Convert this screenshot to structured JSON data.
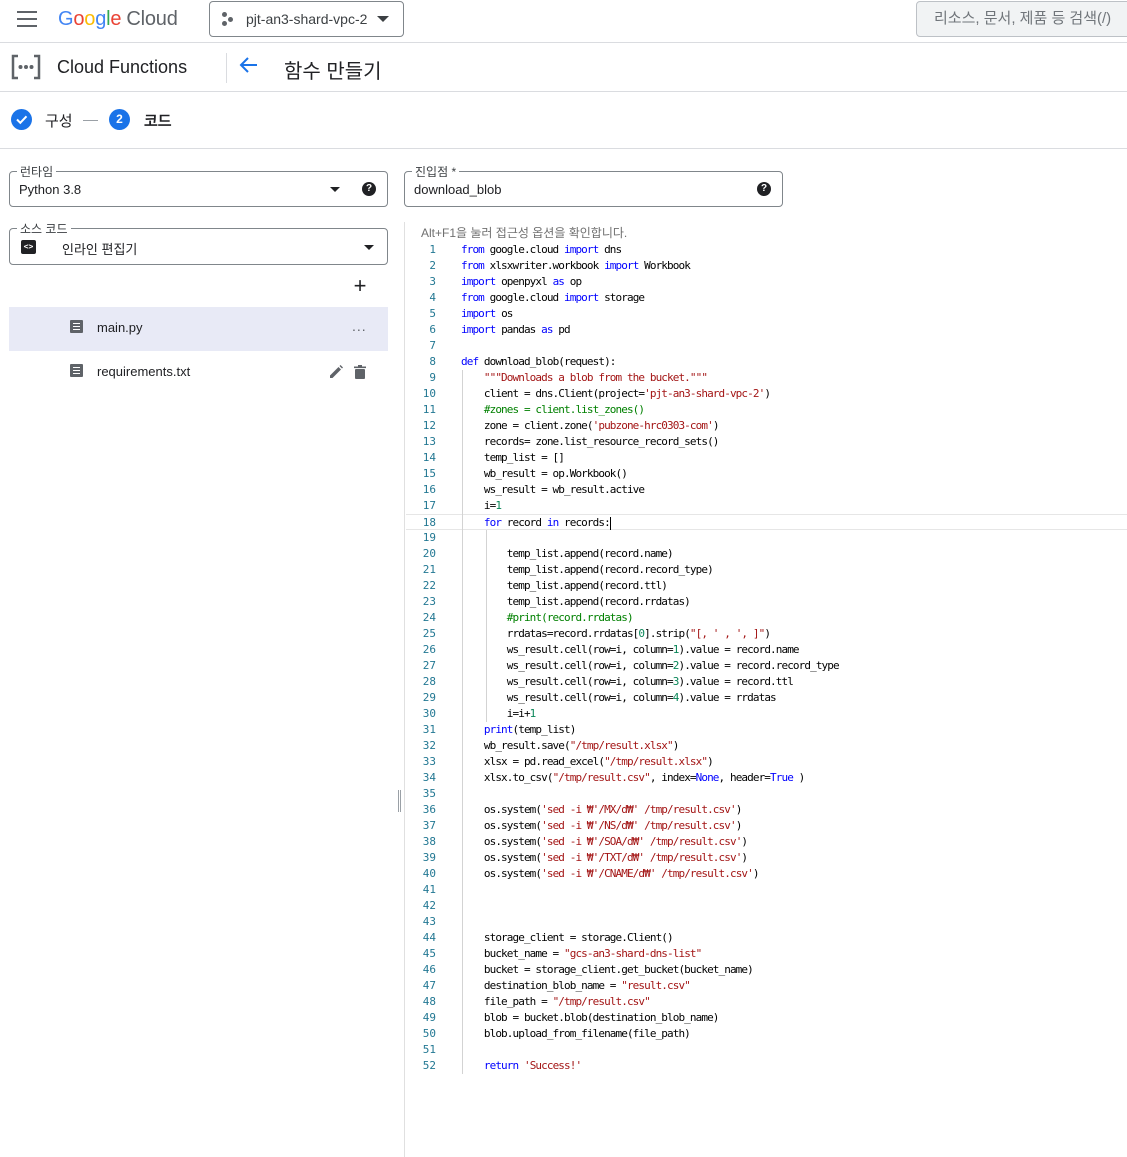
{
  "topbar": {
    "logo_letters": [
      "G",
      "o",
      "o",
      "g",
      "l",
      "e"
    ],
    "logo_cloud": "Cloud",
    "project_name": "pjt-an3-shard-vpc-2",
    "search_placeholder": "리소스, 문서, 제품 등 검색(/)"
  },
  "header": {
    "product_title": "Cloud Functions",
    "page_title": "함수 만들기"
  },
  "stepper": {
    "step1_label": "구성",
    "step2_number": "2",
    "step2_label": "코드"
  },
  "form": {
    "runtime_label": "런타임",
    "runtime_value": "Python 3.8",
    "entry_label": "진입점 *",
    "entry_value": "download_blob",
    "source_label": "소스 코드",
    "source_value": "인라인 편집기",
    "help_glyph": "?",
    "code_badge": "<>"
  },
  "files": [
    {
      "name": "main.py",
      "selected": true
    },
    {
      "name": "requirements.txt",
      "selected": false
    }
  ],
  "file_more_glyph": "...",
  "add_glyph": "+",
  "editor": {
    "a11y_hint": "Alt+F1을 눌러 접근성 옵션을 확인합니다.",
    "current_line": 18,
    "lines": [
      "from google.cloud import dns",
      "from xlsxwriter.workbook import Workbook",
      "import openpyxl as op",
      "from google.cloud import storage",
      "import os",
      "import pandas as pd",
      "",
      "def download_blob(request):",
      "    \"\"\"Downloads a blob from the bucket.\"\"\"",
      "    client = dns.Client(project='pjt-an3-shard-vpc-2')",
      "    #zones = client.list_zones()",
      "    zone = client.zone('pubzone-hrc0303-com')",
      "    records= zone.list_resource_record_sets()",
      "    temp_list = []",
      "    wb_result = op.Workbook()",
      "    ws_result = wb_result.active",
      "    i=1",
      "    for record in records:",
      "",
      "        temp_list.append(record.name)",
      "        temp_list.append(record.record_type)",
      "        temp_list.append(record.ttl)",
      "        temp_list.append(record.rrdatas)",
      "        #print(record.rrdatas)",
      "        rrdatas=record.rrdatas[0].strip(\"[, ' , ', ]\")",
      "        ws_result.cell(row=i, column=1).value = record.name",
      "        ws_result.cell(row=i, column=2).value = record.record_type",
      "        ws_result.cell(row=i, column=3).value = record.ttl",
      "        ws_result.cell(row=i, column=4).value = rrdatas",
      "        i=i+1",
      "    print(temp_list)",
      "    wb_result.save(\"/tmp/result.xlsx\")",
      "    xlsx = pd.read_excel(\"/tmp/result.xlsx\")",
      "    xlsx.to_csv(\"/tmp/result.csv\", index=None, header=True )",
      "",
      "    os.system('sed -i ₩'/MX/d₩' /tmp/result.csv')",
      "    os.system('sed -i ₩'/NS/d₩' /tmp/result.csv')",
      "    os.system('sed -i ₩'/SOA/d₩' /tmp/result.csv')",
      "    os.system('sed -i ₩'/TXT/d₩' /tmp/result.csv')",
      "    os.system('sed -i ₩'/CNAME/d₩' /tmp/result.csv')",
      "",
      "",
      "",
      "    storage_client = storage.Client()",
      "    bucket_name = \"gcs-an3-shard-dns-list\"",
      "    bucket = storage_client.get_bucket(bucket_name)",
      "    destination_blob_name = \"result.csv\"",
      "    file_path = \"/tmp/result.csv\"",
      "    blob = bucket.blob(destination_blob_name)",
      "    blob.upload_from_filename(file_path)",
      "",
      "    return 'Success!'"
    ]
  },
  "colors": {
    "accent": "#1a73e8",
    "selected_file_bg": "#e8eaf6",
    "line_number": "#237893",
    "keyword": "#0000ff",
    "string": "#a31515",
    "number": "#098658",
    "comment": "#008000"
  },
  "icons": {
    "menu": "hamburger-menu-icon",
    "project": "project-hub-icon",
    "product": "cloud-functions-icon",
    "back": "back-arrow-icon",
    "check": "check-icon",
    "help": "help-icon",
    "code": "code-icon",
    "add": "add-icon",
    "file": "file-icon",
    "more": "more-horiz-icon",
    "edit": "edit-icon",
    "delete": "delete-icon"
  }
}
